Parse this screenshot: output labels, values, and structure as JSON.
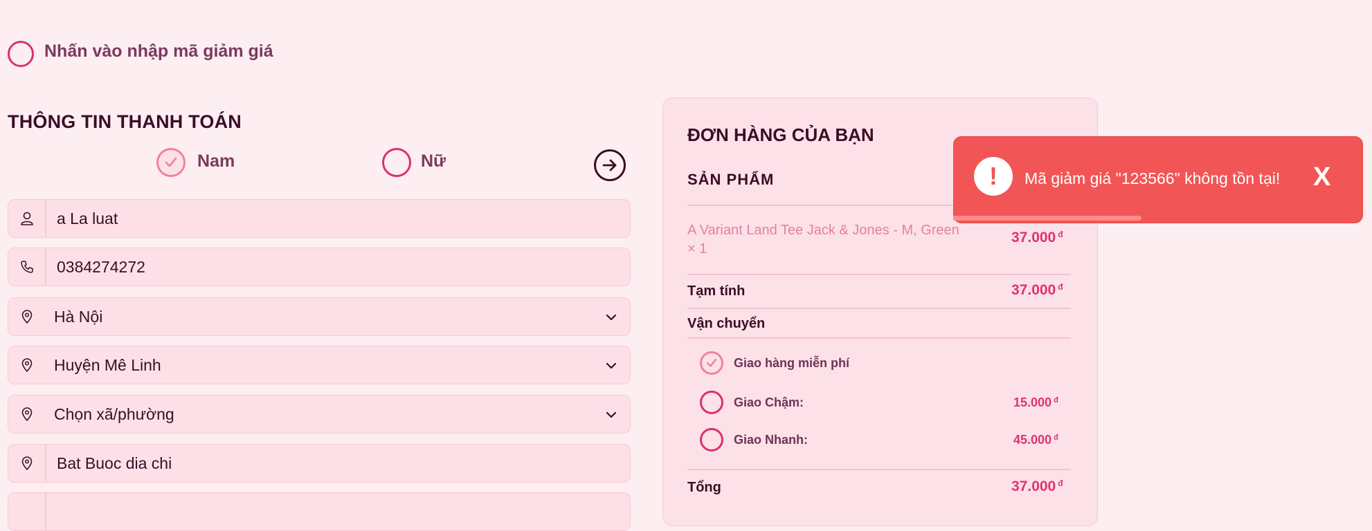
{
  "coupon": {
    "label": "Nhấn vào nhập mã giảm giá"
  },
  "billing": {
    "title": "THÔNG TIN THANH TOÁN",
    "gender": {
      "options": [
        "Nam",
        "Nữ"
      ],
      "selected": "Nam"
    },
    "fields": {
      "name": "a La luat",
      "phone": "0384274272",
      "province": "Hà Nội",
      "district": "Huyện Mê Linh",
      "ward": "Chọn xã/phường",
      "address": "Bat Buoc dia chi"
    }
  },
  "order": {
    "title": "ĐƠN HÀNG CỦA BẠN",
    "product_header": "SẢN PHẨM",
    "item": {
      "name": "A Variant Land Tee Jack & Jones - M, Green",
      "qty": "× 1",
      "price": "37.000"
    },
    "subtotal": {
      "label": "Tạm tính",
      "value": "37.000"
    },
    "shipping": {
      "label": "Vận chuyển",
      "options": [
        {
          "label": "Giao hàng miễn phí",
          "price": "",
          "selected": true
        },
        {
          "label": "Giao Chậm:",
          "price": "15.000",
          "selected": false
        },
        {
          "label": "Giao Nhanh:",
          "price": "45.000",
          "selected": false
        }
      ]
    },
    "total": {
      "label": "Tổng",
      "value": "37.000"
    },
    "currency": "đ"
  },
  "toast": {
    "message": "Mã giảm giá \"123566\" không tồn tại!",
    "icon": "!",
    "close": "X",
    "progress": 0.46,
    "color": "#f25555"
  },
  "colors": {
    "accent": "#e0336f",
    "background": "#fdeef2",
    "field": "#fde0e7"
  }
}
